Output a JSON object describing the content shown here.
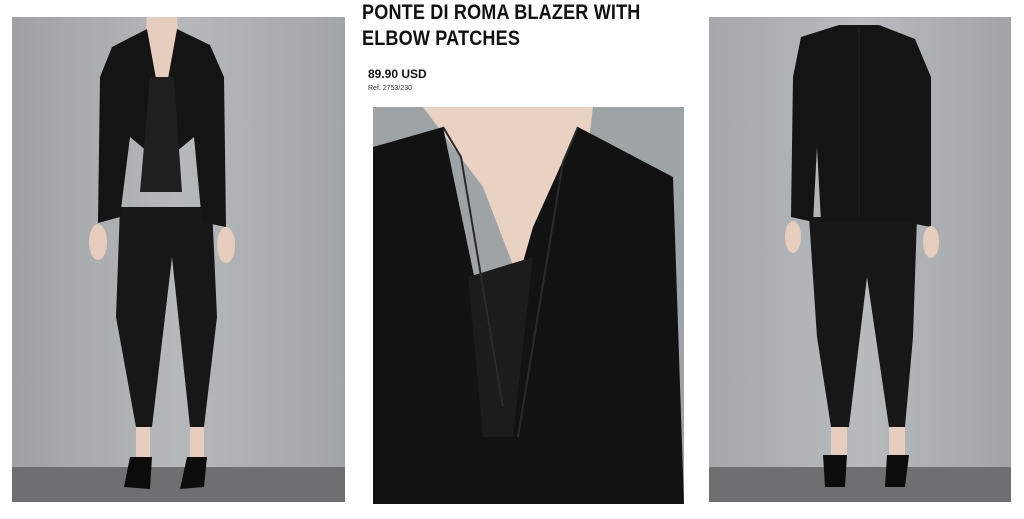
{
  "product": {
    "title": "PONTE DI ROMA BLAZER WITH ELBOW PATCHES",
    "price": "89.90 USD",
    "reference": "Ref. 2753/230"
  },
  "images": [
    {
      "view": "front",
      "subject": "model wearing black blazer and trousers"
    },
    {
      "view": "detail",
      "subject": "close-up of blazer lapel"
    },
    {
      "view": "back",
      "subject": "back view of blazer and trousers"
    }
  ],
  "colors": {
    "backdrop": "#a9adb0",
    "floor": "#6e6f70",
    "garment": "#151515",
    "skin": "#e9d2c2"
  }
}
